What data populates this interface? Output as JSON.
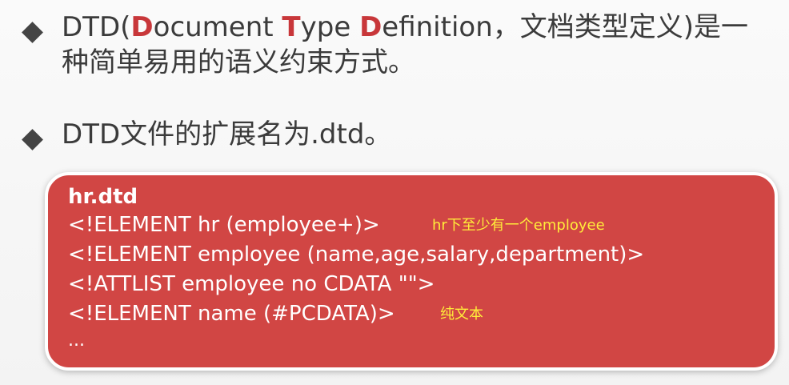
{
  "bullets": [
    {
      "prefix": "DTD(",
      "parts": [
        {
          "hl": "D",
          "rest": "ocument "
        },
        {
          "hl": "T",
          "rest": "ype "
        },
        {
          "hl": "D",
          "rest": "efinition，文档类型定义)是一种简单易用的语义约束方式。"
        }
      ]
    },
    {
      "text": "DTD文件的扩展名为.dtd。"
    }
  ],
  "code_box": {
    "title": "hr.dtd",
    "lines": [
      "<!ELEMENT hr (employee+)>",
      "<!ELEMENT employee (name,age,salary,department)>",
      "<!ATTLIST employee no CDATA \"\">",
      "<!ELEMENT name (#PCDATA)>"
    ],
    "ellipsis": "...",
    "annotations": {
      "line1": "hr下至少有一个employee",
      "line4": "纯文本"
    }
  },
  "colors": {
    "highlight": "#c8373a",
    "box": "#d14644",
    "annotation": "#ffec3a"
  }
}
